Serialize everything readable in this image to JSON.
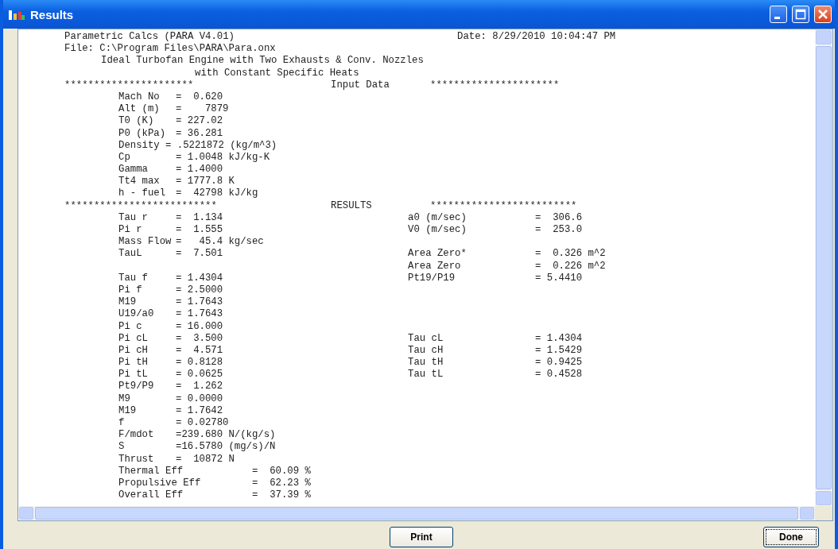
{
  "window": {
    "title": "Results"
  },
  "report": {
    "rows": [
      {
        "kind": "header",
        "text": "Parametric Calcs (PARA V4.01)",
        "right": "Date: 8/29/2010 10:04:47 PM"
      },
      {
        "kind": "header",
        "text": "File: C:\\Program Files\\PARA\\Para.onx"
      },
      {
        "kind": "subtitle",
        "text": "Ideal Turbofan Engine with Two Exhausts & Conv. Nozzles"
      },
      {
        "kind": "subtitle2",
        "text": "with Constant Specific Heats"
      },
      {
        "kind": "divider",
        "left": "**********************",
        "title": "Input Data",
        "right": "**********************"
      },
      {
        "kind": "pair",
        "label": "Mach No",
        "value": "=  0.620"
      },
      {
        "kind": "pair",
        "label": "Alt (m)",
        "value": "=    7879"
      },
      {
        "kind": "pair",
        "label": "T0 (K)",
        "value": "= 227.02"
      },
      {
        "kind": "pair",
        "label": "P0 (kPa)",
        "value": "= 36.281"
      },
      {
        "kind": "inline",
        "label": "Density",
        "value": "= .5221872 (kg/m^3)"
      },
      {
        "kind": "pair",
        "label": "Cp",
        "value": "= 1.0048 kJ/kg-K"
      },
      {
        "kind": "pair",
        "label": "Gamma",
        "value": "= 1.4000"
      },
      {
        "kind": "pair",
        "label": "Tt4 max",
        "value": "= 1777.8 K"
      },
      {
        "kind": "pair",
        "label": "h - fuel",
        "value": "=  42798 kJ/kg"
      },
      {
        "kind": "divider",
        "left": "**************************",
        "title": "RESULTS",
        "right": "*************************"
      },
      {
        "kind": "pair",
        "label": "Tau r",
        "value": "=  1.134",
        "right_label": "a0 (m/sec)",
        "right_value": "=  306.6"
      },
      {
        "kind": "pair",
        "label": "Pi r",
        "value": "=  1.555",
        "right_label": "V0 (m/sec)",
        "right_value": "=  253.0"
      },
      {
        "kind": "pair",
        "label": "Mass Flow",
        "value": "=   45.4 kg/sec"
      },
      {
        "kind": "pair",
        "label": "TauL",
        "value": "=  7.501",
        "right_label": "Area Zero*",
        "right_value": "=  0.326 m^2"
      },
      {
        "kind": "pair",
        "right_label": "Area Zero",
        "right_value": "=  0.226 m^2"
      },
      {
        "kind": "pair",
        "label": "Tau f",
        "value": "= 1.4304",
        "right_label": "Pt19/P19",
        "right_value": "= 5.4410"
      },
      {
        "kind": "pair",
        "label": "Pi f",
        "value": "= 2.5000"
      },
      {
        "kind": "pair",
        "label": "M19",
        "value": "= 1.7643"
      },
      {
        "kind": "pair",
        "label": "U19/a0",
        "value": "= 1.7643"
      },
      {
        "kind": "pair",
        "label": "Pi c",
        "value": "= 16.000"
      },
      {
        "kind": "pair",
        "label": "Pi cL",
        "value": "=  3.500",
        "right_label": "Tau cL",
        "right_value": "= 1.4304"
      },
      {
        "kind": "pair",
        "label": "Pi cH",
        "value": "=  4.571",
        "right_label": "Tau cH",
        "right_value": "= 1.5429"
      },
      {
        "kind": "pair",
        "label": "Pi tH",
        "value": "= 0.8128",
        "right_label": "Tau tH",
        "right_value": "= 0.9425"
      },
      {
        "kind": "pair",
        "label": "Pi tL",
        "value": "= 0.0625",
        "right_label": "Tau tL",
        "right_value": "= 0.4528"
      },
      {
        "kind": "pair",
        "label": "Pt9/P9",
        "value": "=  1.262"
      },
      {
        "kind": "pair",
        "label": "M9",
        "value": "= 0.0000"
      },
      {
        "kind": "pair",
        "label": "M19",
        "value": "= 1.7642"
      },
      {
        "kind": "pair",
        "label": "f",
        "value": "= 0.02780"
      },
      {
        "kind": "pair",
        "label": "F/mdot",
        "value": "=239.680 N/(kg/s)"
      },
      {
        "kind": "pair",
        "label": "S",
        "value": "=16.5780 (mg/s)/N"
      },
      {
        "kind": "pair",
        "label": "Thrust",
        "value": "=  10872 N"
      },
      {
        "kind": "wide",
        "label": "Thermal Eff",
        "value": "=  60.09 %"
      },
      {
        "kind": "wide",
        "label": "Propulsive Eff",
        "value": "=  62.23 %"
      },
      {
        "kind": "wide",
        "label": "Overall Eff",
        "value": "=  37.39 %"
      }
    ]
  },
  "buttons": [
    {
      "label": "Print",
      "focused": false
    },
    {
      "label": "Done",
      "focused": true
    }
  ]
}
